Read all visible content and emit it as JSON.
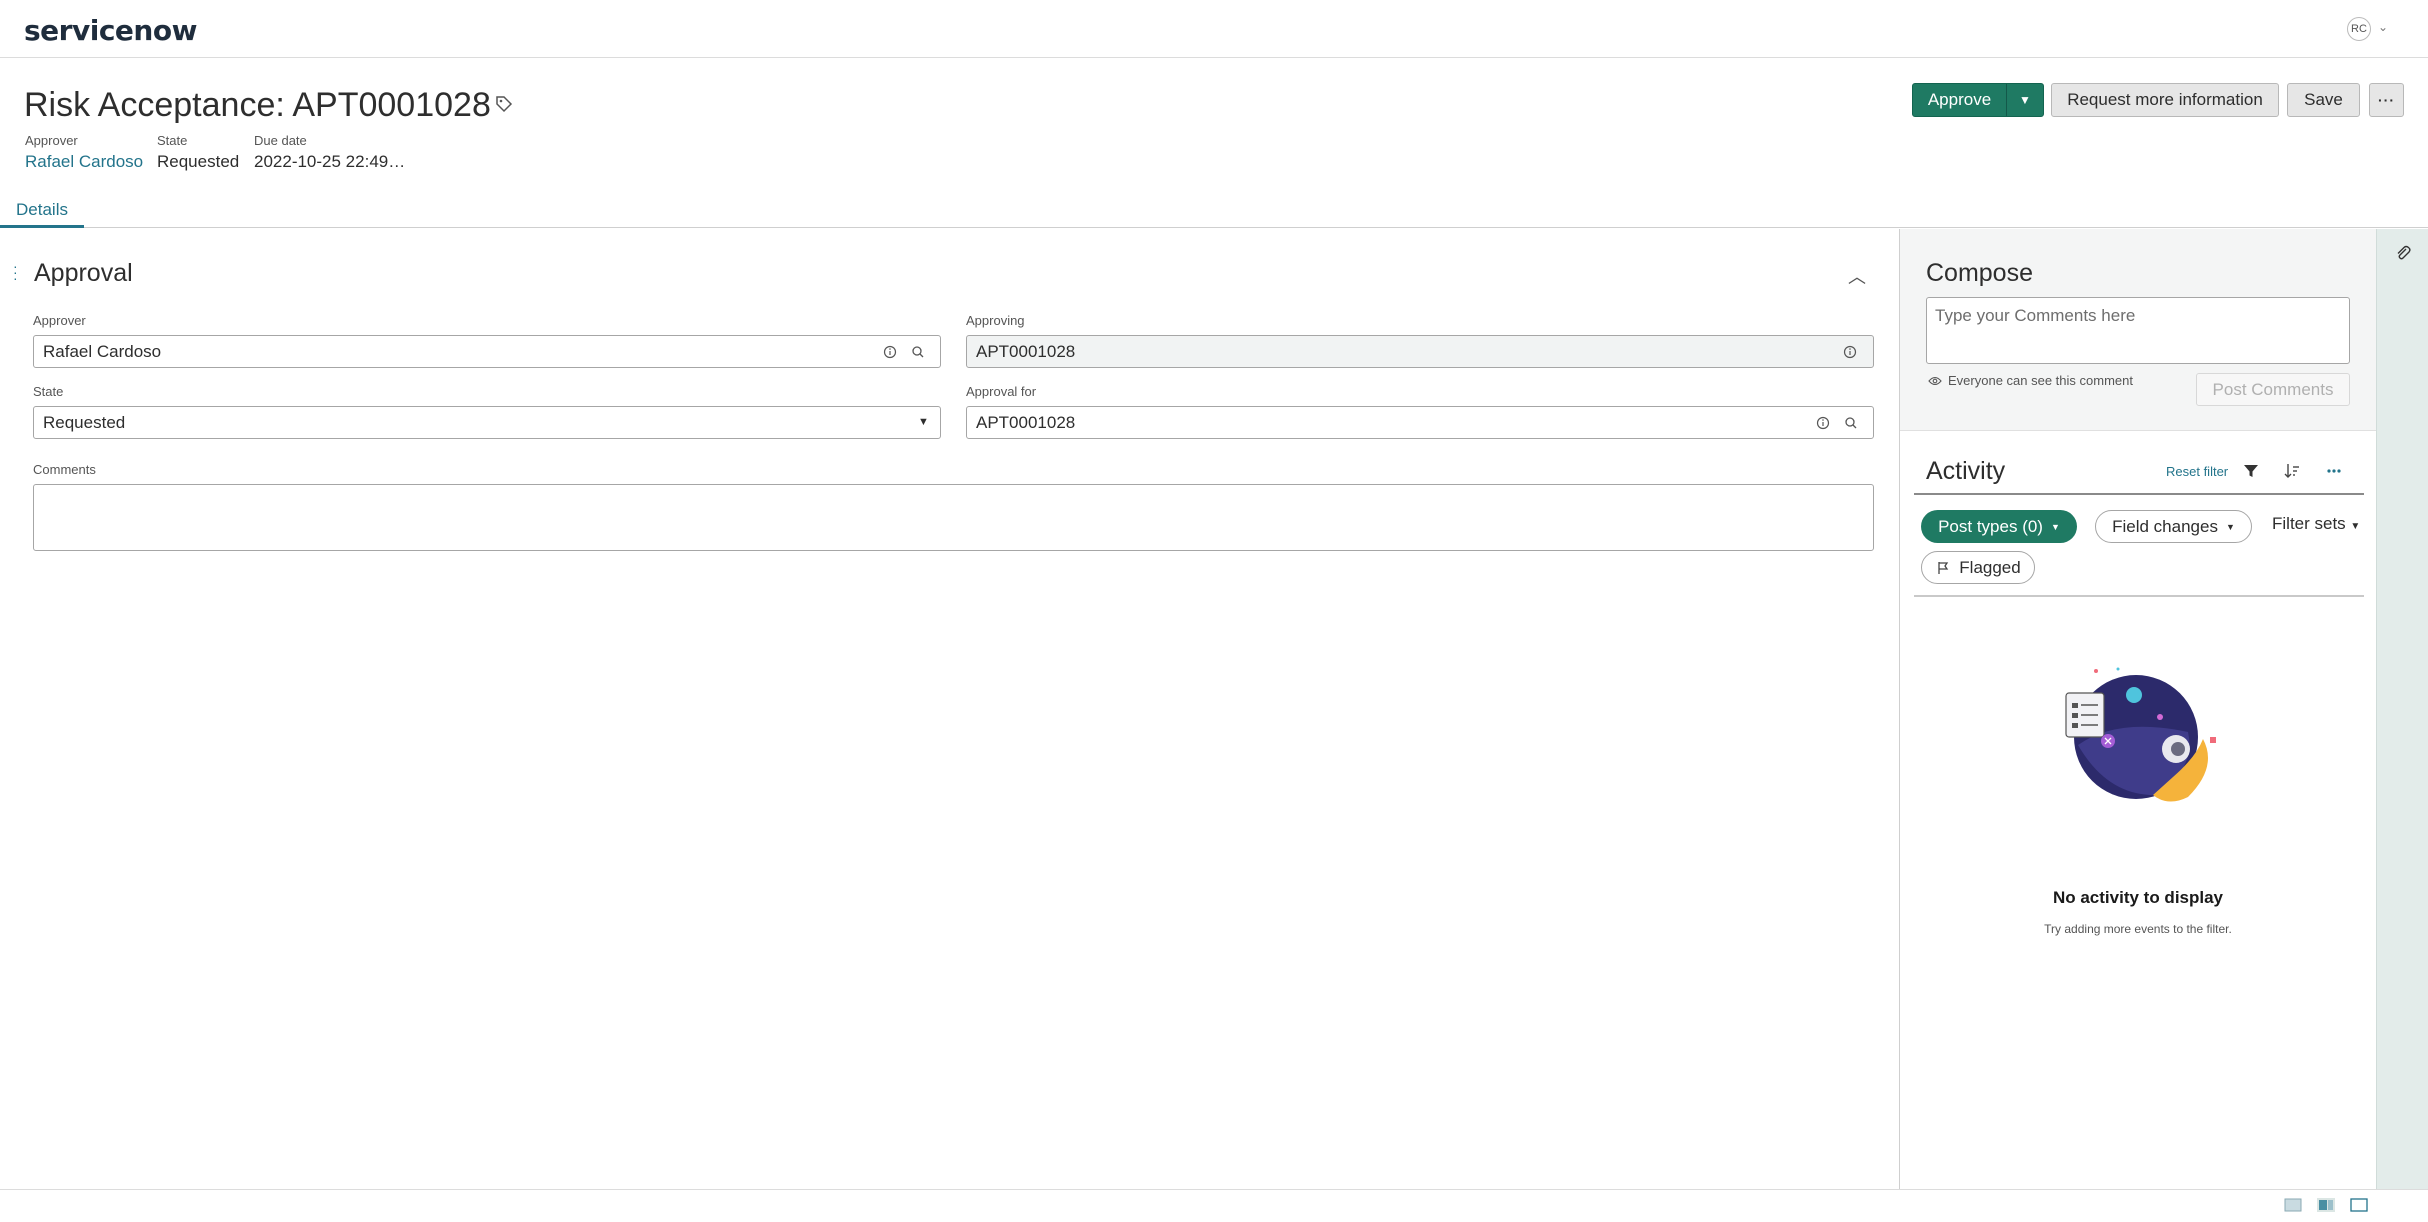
{
  "app": {
    "logo": "servicenow",
    "logo_o": "o",
    "user_initials": "RC"
  },
  "record": {
    "title": "Risk Acceptance: APT0001028",
    "meta": [
      {
        "label": "Approver",
        "value": "Rafael Cardoso"
      },
      {
        "label": "State",
        "value": "Requested"
      },
      {
        "label": "Due date",
        "value": "2022-10-25 22:49…"
      }
    ]
  },
  "actions": {
    "approve": "Approve",
    "request_info": "Request more information",
    "save": "Save",
    "more": "···"
  },
  "tabs": [
    {
      "label": "Details"
    }
  ],
  "form": {
    "section_title": "Approval",
    "approver": {
      "label": "Approver",
      "value": "Rafael Cardoso"
    },
    "approving": {
      "label": "Approving",
      "value": "APT0001028"
    },
    "state": {
      "label": "State",
      "value": "Requested"
    },
    "approval_for": {
      "label": "Approval for",
      "value": "APT0001028"
    },
    "comments": {
      "label": "Comments",
      "value": ""
    }
  },
  "compose": {
    "title": "Compose",
    "placeholder": "Type your Comments here",
    "visibility": "Everyone can see this comment",
    "post_label": "Post Comments"
  },
  "activity": {
    "title": "Activity",
    "reset_filter": "Reset filter",
    "filters": {
      "post_types": "Post types (0)",
      "field_changes": "Field changes",
      "filter_sets": "Filter sets",
      "flagged": "Flagged"
    },
    "empty_title": "No activity to display",
    "empty_sub": "Try adding more events to the filter."
  },
  "colors": {
    "accent": "#1f7a63",
    "link": "#23748b",
    "rail": "#e3ecea"
  }
}
